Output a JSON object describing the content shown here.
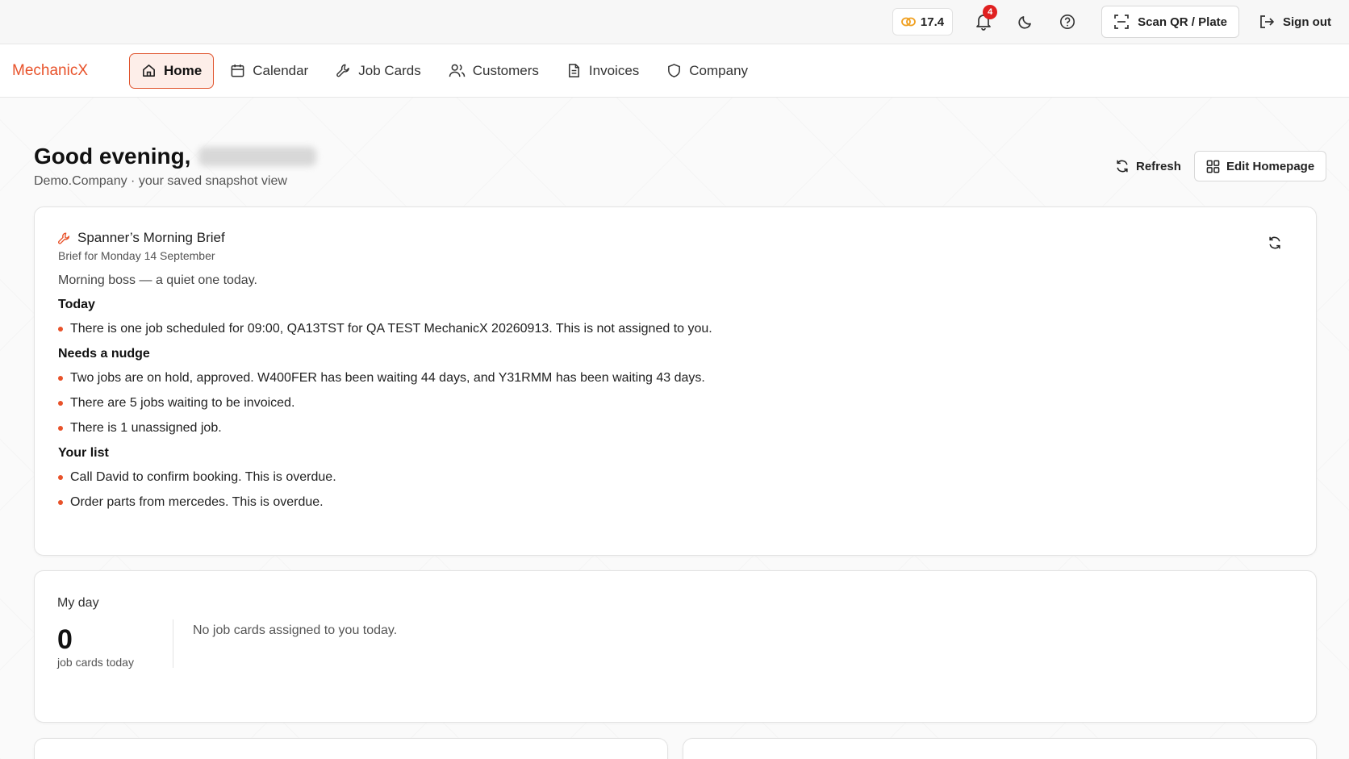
{
  "topbar": {
    "credits_value": "17.4",
    "notifications_count": "4",
    "scan_label": "Scan QR / Plate",
    "signout_label": "Sign out"
  },
  "nav": {
    "brand": "MechanicX",
    "items": [
      {
        "label": "Home",
        "icon": "home-icon",
        "active": true
      },
      {
        "label": "Calendar",
        "icon": "calendar-icon"
      },
      {
        "label": "Job Cards",
        "icon": "wrench-icon"
      },
      {
        "label": "Customers",
        "icon": "users-icon"
      },
      {
        "label": "Invoices",
        "icon": "document-icon"
      },
      {
        "label": "Company",
        "icon": "shield-icon"
      }
    ]
  },
  "header": {
    "greeting": "Good evening,",
    "subtitle": "Demo.Company · your saved snapshot view",
    "refresh_label": "Refresh",
    "edit_label": "Edit Homepage"
  },
  "brief": {
    "title": "Spanner’s Morning Brief",
    "date": "Brief for Monday 14 September",
    "intro": "Morning boss — a quiet one today.",
    "sections": [
      {
        "title": "Today",
        "bullets": [
          "There is one job scheduled for 09:00, QA13TST for QA TEST MechanicX 20260913. This is not assigned to you."
        ]
      },
      {
        "title": "Needs a nudge",
        "bullets": [
          "Two jobs are on hold, approved. W400FER has been waiting 44 days, and Y31RMM has been waiting 43 days.",
          "There are 5 jobs waiting to be invoiced.",
          "There is 1 unassigned job."
        ]
      },
      {
        "title": "Your list",
        "bullets": [
          "Call David to confirm booking. This is overdue.",
          "Order parts from mercedes. This is overdue."
        ]
      }
    ]
  },
  "myday": {
    "title": "My day",
    "count": "0",
    "count_label": "job cards today",
    "empty_message": "No job cards assigned to you today."
  },
  "colors": {
    "accent": "#e8522a",
    "badge": "#e02020",
    "credits_icon": "#f0a020"
  }
}
